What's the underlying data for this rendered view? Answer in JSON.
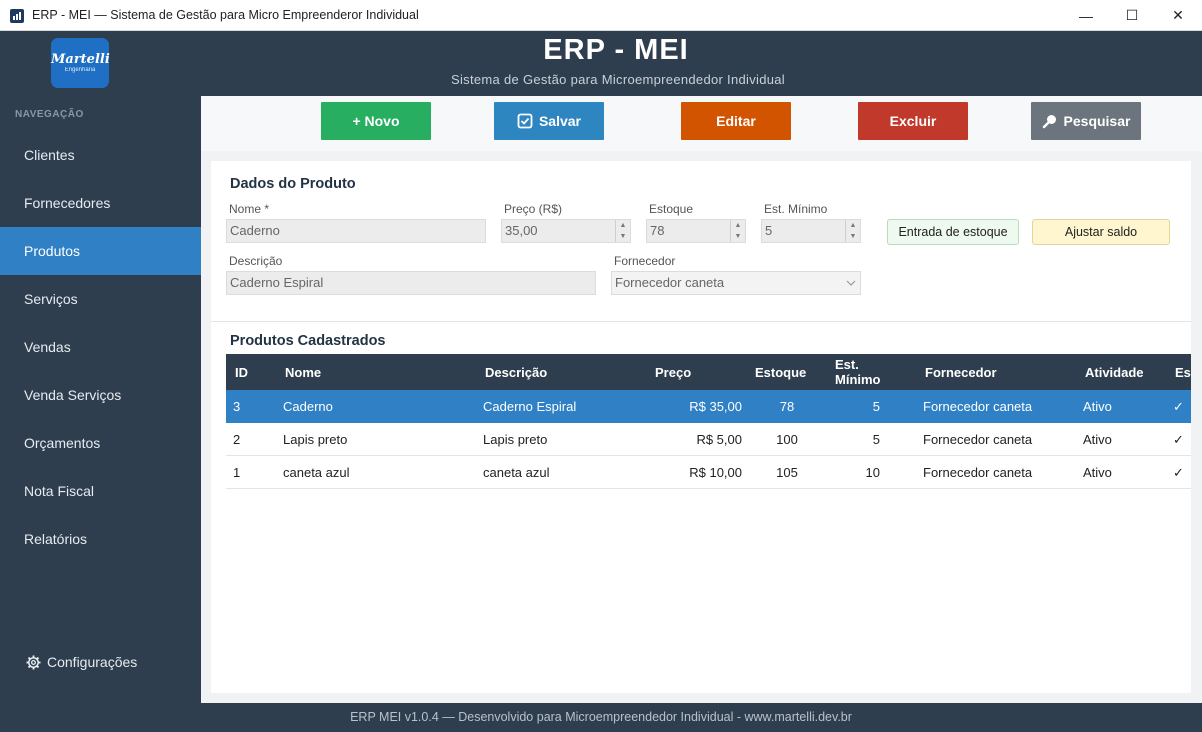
{
  "window": {
    "title": "ERP - MEI — Sistema de Gestão para Micro Empreenderor Individual",
    "minimize": "—",
    "maximize": "☐",
    "close": "✕"
  },
  "header": {
    "logo_text": "Martelli",
    "logo_sub": "Engenharia",
    "title": "ERP - MEI",
    "subtitle": "Sistema de Gestão para Microempreendedor Individual"
  },
  "sidebar": {
    "heading": "NAVEGAÇÃO",
    "items": [
      {
        "label": "Clientes"
      },
      {
        "label": "Fornecedores"
      },
      {
        "label": "Produtos"
      },
      {
        "label": "Serviços"
      },
      {
        "label": "Vendas"
      },
      {
        "label": "Venda Serviços"
      },
      {
        "label": "Orçamentos"
      },
      {
        "label": "Nota Fiscal"
      },
      {
        "label": "Relatórios"
      }
    ],
    "active_index": 2,
    "config_label": "Configurações"
  },
  "toolbar": {
    "new_label": "+ Novo",
    "save_label": "Salvar",
    "edit_label": "Editar",
    "delete_label": "Excluir",
    "search_label": "Pesquisar"
  },
  "form": {
    "section_title": "Dados do Produto",
    "name_label": "Nome *",
    "name_value": "Caderno",
    "price_label": "Preço (R$)",
    "price_value": "35,00",
    "stock_label": "Estoque",
    "stock_value": "78",
    "min_stock_label": "Est. Mínimo",
    "min_stock_value": "5",
    "description_label": "Descrição",
    "description_value": "Caderno Espiral",
    "supplier_label": "Fornecedor",
    "supplier_value": "Fornecedor caneta",
    "stock_entry_label": "Entrada de estoque",
    "adjust_balance_label": "Ajustar saldo"
  },
  "table": {
    "section_title": "Produtos Cadastrados",
    "columns": [
      "ID",
      "Nome",
      "Descrição",
      "Preço",
      "Estoque",
      "Est.",
      "Mínimo",
      "Fornecedor",
      "Atividade",
      "Es"
    ],
    "rows": [
      {
        "id": "3",
        "nome": "Caderno",
        "descricao": "Caderno Espiral",
        "preco": "R$ 35,00",
        "estoque": "78",
        "minimo": "5",
        "fornecedor": "Fornecedor caneta",
        "atividade": "Ativo",
        "check": "✓"
      },
      {
        "id": "2",
        "nome": "Lapis preto",
        "descricao": "Lapis preto",
        "preco": "R$ 5,00",
        "estoque": "100",
        "minimo": "5",
        "fornecedor": "Fornecedor caneta",
        "atividade": "Ativo",
        "check": "✓"
      },
      {
        "id": "1",
        "nome": "caneta azul",
        "descricao": "caneta azul",
        "preco": "R$ 10,00",
        "estoque": "105",
        "minimo": "10",
        "fornecedor": "Fornecedor caneta",
        "atividade": "Ativo",
        "check": "✓"
      }
    ],
    "selected_index": 0
  },
  "footer": {
    "text": "ERP MEI v1.0.4  —  Desenvolvido para Microempreendedor Individual  -  www.martelli.dev.br"
  },
  "colors": {
    "sidebar_bg": "#2f3e4e",
    "accent": "#2f80c4",
    "novo": "#27ae60",
    "salvar": "#2e86c1",
    "editar": "#d35400",
    "excluir": "#c0392b",
    "pesquisar": "#6c757d"
  },
  "icons": {
    "save": "checkbox-icon",
    "search": "magnifier-icon",
    "config": "gear-icon",
    "app": "chart-bars-icon"
  }
}
